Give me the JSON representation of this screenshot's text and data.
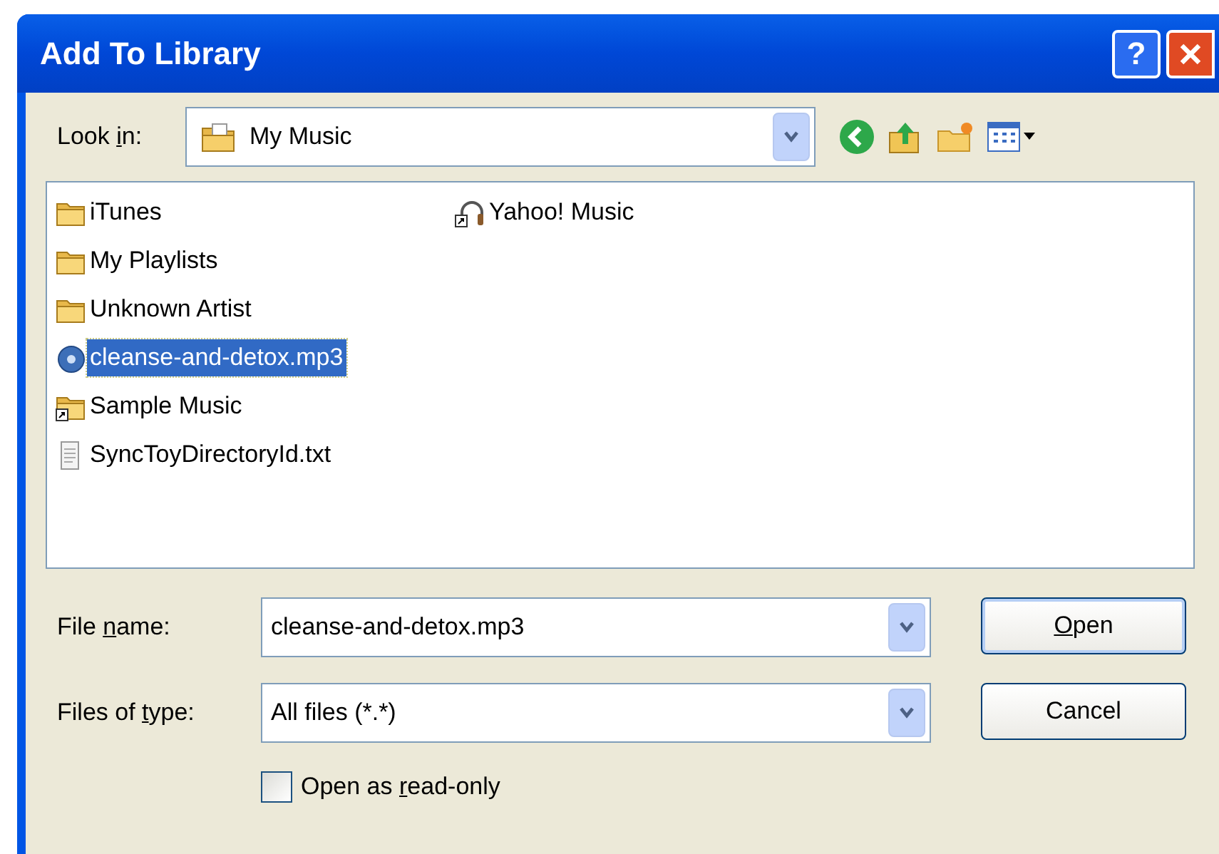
{
  "window": {
    "title": "Add To Library",
    "help_button": "?"
  },
  "look_in": {
    "label_parts": [
      {
        "text": "Look ",
        "underlined": false
      },
      {
        "text": "i",
        "underlined": true
      },
      {
        "text": "n:",
        "underlined": false
      }
    ],
    "value": "My Music"
  },
  "file_columns": [
    [
      {
        "name": "iTunes",
        "kind": "folder",
        "selected": false
      },
      {
        "name": "My Playlists",
        "kind": "folder",
        "selected": false
      },
      {
        "name": "Unknown Artist",
        "kind": "folder",
        "selected": false
      },
      {
        "name": "cleanse-and-detox.mp3",
        "kind": "audio",
        "selected": true
      },
      {
        "name": "Sample Music",
        "kind": "folder-shortcut",
        "selected": false
      },
      {
        "name": "SyncToyDirectoryId.txt",
        "kind": "text",
        "selected": false
      }
    ],
    [
      {
        "name": "Yahoo! Music",
        "kind": "headphones-shortcut",
        "selected": false
      }
    ]
  ],
  "file_name": {
    "label_parts": [
      {
        "text": "File ",
        "underlined": false
      },
      {
        "text": "n",
        "underlined": true
      },
      {
        "text": "ame:",
        "underlined": false
      }
    ],
    "value": "cleanse-and-detox.mp3"
  },
  "file_type": {
    "label_parts": [
      {
        "text": "Files of ",
        "underlined": false
      },
      {
        "text": "t",
        "underlined": true
      },
      {
        "text": "ype:",
        "underlined": false
      }
    ],
    "value": "All files (*.*)"
  },
  "buttons": [
    {
      "label_parts": [
        {
          "text": "O",
          "underlined": true
        },
        {
          "text": "pen",
          "underlined": false
        }
      ],
      "default": true
    },
    {
      "label_parts": [
        {
          "text": "Cancel",
          "underlined": false
        }
      ],
      "default": false
    }
  ],
  "read_only": {
    "label_parts": [
      {
        "text": "Open as ",
        "underlined": false
      },
      {
        "text": "r",
        "underlined": true
      },
      {
        "text": "ead-only",
        "underlined": false
      }
    ],
    "checked": false
  }
}
